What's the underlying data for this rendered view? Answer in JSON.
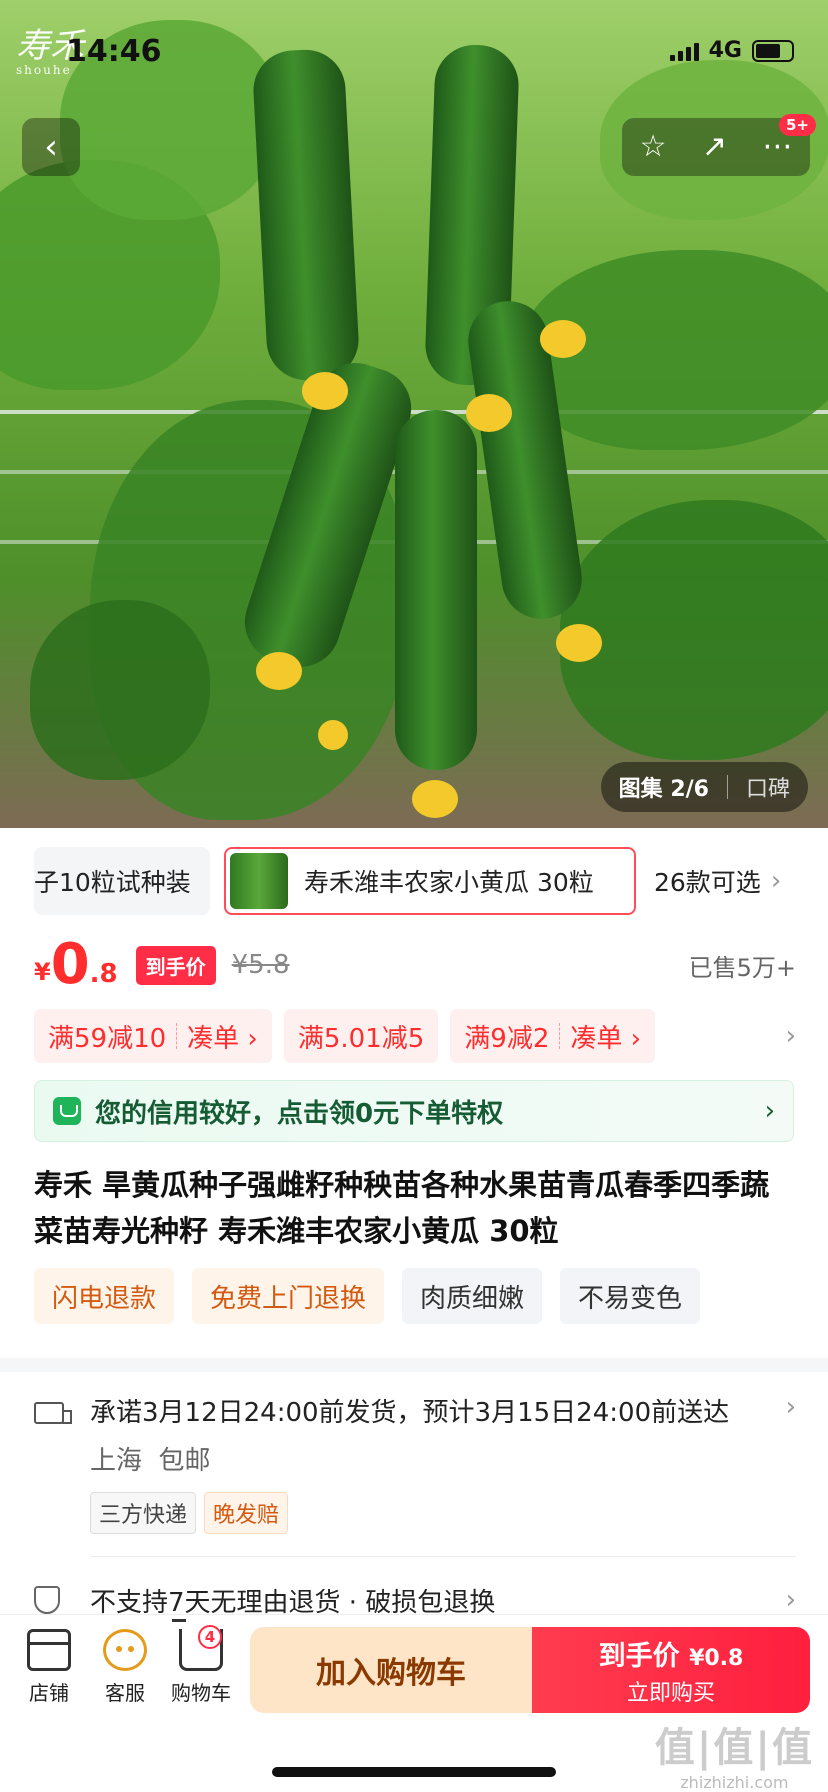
{
  "status_bar": {
    "time": "14:46",
    "network": "4G"
  },
  "hero": {
    "logo_text": "寿禾",
    "logo_sub": "shouhe",
    "more_badge": "5+",
    "gallery_label": "图集 2/6",
    "reviews_label": "口碑"
  },
  "sku": {
    "prev_option": "子10粒试种装",
    "selected_option": "寿禾潍丰农家小黄瓜 30粒",
    "more_label": "26款可选"
  },
  "price": {
    "currency": "¥",
    "integer": "0",
    "decimal": ".8",
    "tag": "到手价",
    "original": "¥5.8",
    "sold": "已售5万+"
  },
  "coupons": [
    {
      "text": "满59减10",
      "action": "凑单 ›"
    },
    {
      "text": "满5.01减5",
      "action": ""
    },
    {
      "text": "满9减2",
      "action": "凑单 ›"
    }
  ],
  "credit_banner": {
    "text": "您的信用较好，点击领0元下单特权"
  },
  "product_title": "寿禾 旱黄瓜种子强雌籽种秧苗各种水果苗青瓜春季四季蔬菜苗寿光种籽 寿禾潍丰农家小黄瓜 30粒",
  "features": [
    "闪电退款",
    "免费上门退换",
    "肉质细嫩",
    "不易变色"
  ],
  "delivery": {
    "promise": "承诺3月12日24:00前发货，预计3月15日24:00前送达",
    "origin": "上海",
    "shipping": "包邮",
    "tags": [
      "三方快递",
      "晚发赔"
    ]
  },
  "returns": {
    "text": "不支持7天无理由退货 · 破损包退换"
  },
  "bottom_bar": {
    "store_label": "店铺",
    "service_label": "客服",
    "cart_label": "购物车",
    "cart_count": "4",
    "add_cart_label": "加入购物车",
    "buy_price_label": "到手价",
    "buy_price": "¥0.8",
    "buy_now_label": "立即购买"
  },
  "watermark": {
    "main": "值|值|值",
    "sub": "zhizhizhi.com"
  },
  "colors": {
    "accent_red": "#ff2d46",
    "price_red": "#ff2d2d",
    "credit_green": "#1fb35a",
    "orange_tag": "#d35a10"
  }
}
